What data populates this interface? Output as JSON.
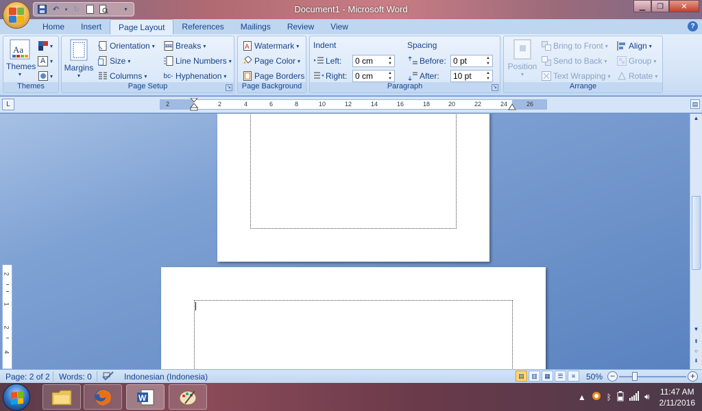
{
  "window": {
    "title": "Document1 - Microsoft Word"
  },
  "tabs": [
    "Home",
    "Insert",
    "Page Layout",
    "References",
    "Mailings",
    "Review",
    "View"
  ],
  "active_tab": "Page Layout",
  "ribbon": {
    "themes": {
      "themes_label": "Themes",
      "group_label": "Themes"
    },
    "page_setup": {
      "margins_label": "Margins",
      "orientation_label": "Orientation",
      "size_label": "Size",
      "columns_label": "Columns",
      "breaks_label": "Breaks",
      "line_numbers_label": "Line Numbers",
      "hyphenation_label": "Hyphenation",
      "group_label": "Page Setup"
    },
    "page_background": {
      "watermark_label": "Watermark",
      "page_color_label": "Page Color",
      "page_borders_label": "Page Borders",
      "group_label": "Page Background"
    },
    "paragraph": {
      "indent_header": "Indent",
      "left_label": "Left:",
      "left_value": "0 cm",
      "right_label": "Right:",
      "right_value": "0 cm",
      "spacing_header": "Spacing",
      "before_label": "Before:",
      "before_value": "0 pt",
      "after_label": "After:",
      "after_value": "10 pt",
      "group_label": "Paragraph"
    },
    "arrange": {
      "position_label": "Position",
      "bring_to_front_label": "Bring to Front",
      "send_to_back_label": "Send to Back",
      "text_wrapping_label": "Text Wrapping",
      "align_label": "Align",
      "group_label_btn": "Group",
      "rotate_label": "Rotate",
      "group_label": "Arrange"
    }
  },
  "ruler": {
    "tab_selector": "L",
    "labels": [
      "2",
      "2",
      "4",
      "6",
      "8",
      "10",
      "12",
      "14",
      "16",
      "18",
      "20",
      "22",
      "24",
      "26"
    ],
    "vertical_labels": [
      "2",
      "1",
      "2",
      "4"
    ]
  },
  "statusbar": {
    "page": "Page: 2 of 2",
    "words": "Words: 0",
    "language": "Indonesian (Indonesia)",
    "zoom": "50%"
  },
  "taskbar": {
    "time": "11:47 AM",
    "date": "2/11/2016"
  },
  "colors": {
    "ribbon_text": "#15428b",
    "accent": "#3a72c4"
  }
}
